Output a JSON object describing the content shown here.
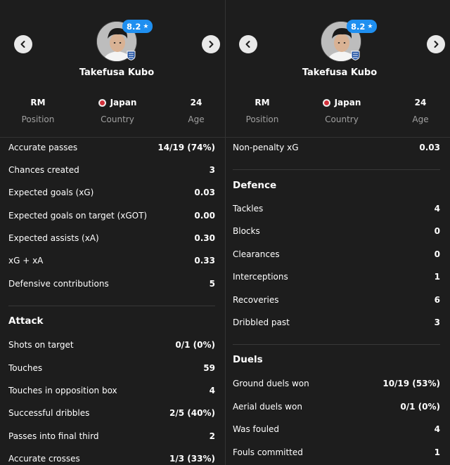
{
  "player": {
    "rating": "8.2",
    "rating_star": "★",
    "name": "Takefusa Kubo",
    "position": "RM",
    "position_label": "Position",
    "country": "Japan",
    "country_label": "Country",
    "age": "24",
    "age_label": "Age"
  },
  "colors": {
    "rating_badge": "#1f8ff0",
    "background": "#1d1d1d",
    "flag_red": "#d0303a"
  },
  "icons": {
    "prev": "chevron-left-icon",
    "next": "chevron-right-icon",
    "club": "club-crest-icon"
  },
  "left_stats": [
    {
      "name": "Accurate passes",
      "value": "14/19 (74%)"
    },
    {
      "name": "Chances created",
      "value": "3"
    },
    {
      "name": "Expected goals (xG)",
      "value": "0.03"
    },
    {
      "name": "Expected goals on target (xGOT)",
      "value": "0.00"
    },
    {
      "name": "Expected assists (xA)",
      "value": "0.30"
    },
    {
      "name": "xG + xA",
      "value": "0.33"
    },
    {
      "name": "Defensive contributions",
      "value": "5"
    }
  ],
  "attack": {
    "title": "Attack",
    "stats": [
      {
        "name": "Shots on target",
        "value": "0/1 (0%)"
      },
      {
        "name": "Touches",
        "value": "59"
      },
      {
        "name": "Touches in opposition box",
        "value": "4"
      },
      {
        "name": "Successful dribbles",
        "value": "2/5 (40%)"
      },
      {
        "name": "Passes into final third",
        "value": "2"
      },
      {
        "name": "Accurate crosses",
        "value": "1/3 (33%)"
      }
    ]
  },
  "right_top": [
    {
      "name": "Non-penalty xG",
      "value": "0.03"
    }
  ],
  "defence": {
    "title": "Defence",
    "stats": [
      {
        "name": "Tackles",
        "value": "4"
      },
      {
        "name": "Blocks",
        "value": "0"
      },
      {
        "name": "Clearances",
        "value": "0"
      },
      {
        "name": "Interceptions",
        "value": "1"
      },
      {
        "name": "Recoveries",
        "value": "6"
      },
      {
        "name": "Dribbled past",
        "value": "3"
      }
    ]
  },
  "duels": {
    "title": "Duels",
    "stats": [
      {
        "name": "Ground duels won",
        "value": "10/19 (53%)"
      },
      {
        "name": "Aerial duels won",
        "value": "0/1 (0%)"
      },
      {
        "name": "Was fouled",
        "value": "4"
      },
      {
        "name": "Fouls committed",
        "value": "1"
      }
    ]
  }
}
